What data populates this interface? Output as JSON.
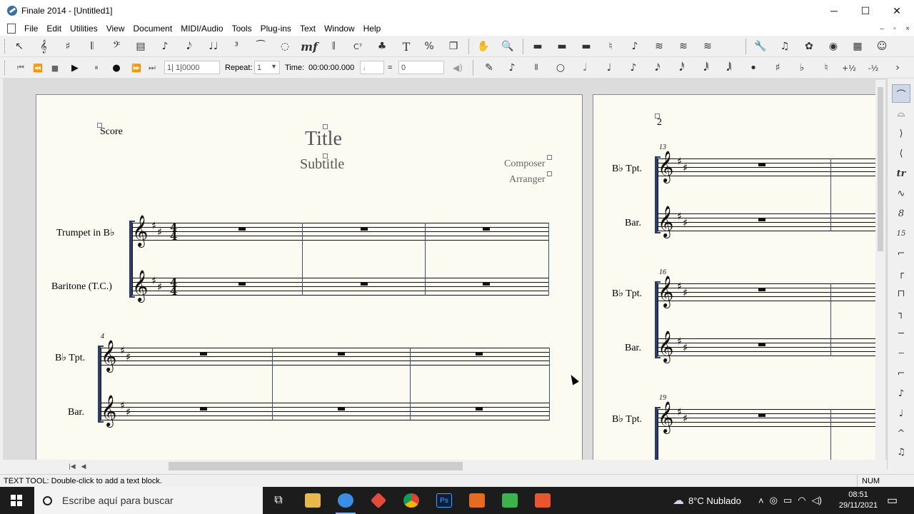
{
  "window": {
    "title": "Finale 2014 - [Untitled1]",
    "minimize": "─",
    "maximize": "☐",
    "close": "✕"
  },
  "menu": {
    "items": [
      "File",
      "Edit",
      "Utilities",
      "View",
      "Document",
      "MIDI/Audio",
      "Tools",
      "Plug-ins",
      "Text",
      "Window",
      "Help"
    ],
    "doc_min": "–",
    "doc_restore": "▫",
    "doc_close": "×"
  },
  "toolbar1": {
    "tools": [
      "↖",
      "𝄞",
      "♯",
      "𝄃",
      "𝄢",
      "▤",
      "♪",
      "𝅘𝅥𝅮",
      "♩♩",
      "³",
      "⁀",
      "◌",
      "mf",
      "𝄂",
      "C⁷",
      "♣",
      "T",
      "%",
      "❐",
      "✋",
      "🔍",
      "▬",
      "▬",
      "▬",
      "♮",
      "♪",
      "≋",
      "≋",
      "≋",
      "🔧",
      "♫",
      "✿",
      "◉",
      "▦",
      "☺"
    ]
  },
  "transport": {
    "rewind": "⏮",
    "back": "⏪",
    "stop": "■",
    "play": "▶",
    "pause": "⏸",
    "record": "●",
    "forward": "⏩",
    "end": "⏭"
  },
  "counter": {
    "position": "1| 1|0000",
    "repeat_label": "Repeat:",
    "repeat_value": "1",
    "time_label": "Time:",
    "time_value": "00:00:00.000",
    "eq": "=",
    "tempo_value": "0"
  },
  "toolbar2": {
    "tools": [
      "✎",
      "♪",
      "⦀",
      "○",
      "𝅗𝅥",
      "♩",
      "♪",
      "𝅘𝅥𝅯",
      "𝅘𝅥𝅰",
      "𝅘𝅥𝅱",
      "𝅘𝅥𝅲",
      "•",
      "♯",
      "♭",
      "♮",
      "+½",
      "-½"
    ]
  },
  "page1": {
    "score_label": "Score",
    "title": "Title",
    "subtitle": "Subtitle",
    "composer": "Composer",
    "arranger": "Arranger",
    "system1": {
      "staff_names": [
        "Trumpet in B♭",
        "Baritone (T.C.)"
      ],
      "time_sig_top": "4",
      "time_sig_bottom": "4"
    },
    "system2": {
      "measure_number": "4",
      "staff_names": [
        "B♭ Tpt.",
        "Bar."
      ]
    }
  },
  "page2": {
    "page_number": "2",
    "systems": [
      {
        "measure_number": "13",
        "staff_names": [
          "B♭ Tpt.",
          "Bar."
        ]
      },
      {
        "measure_number": "16",
        "staff_names": [
          "B♭ Tpt.",
          "Bar."
        ]
      },
      {
        "measure_number": "19",
        "staff_names": [
          "B♭ Tpt."
        ]
      }
    ]
  },
  "palette": {
    "tools": [
      "⌒",
      "⌓",
      "⟩",
      "⟨",
      "tr",
      "∿",
      "8",
      "15",
      "⌐",
      "┌",
      "⊓",
      "┐",
      "─",
      "┄",
      "⌐",
      "♪",
      "♩",
      "^",
      "♫",
      "✱"
    ]
  },
  "status": {
    "text": "TEXT TOOL: Double-click to add a text block.",
    "num": "NUM"
  },
  "taskbar": {
    "search_placeholder": "Escribe aquí para buscar",
    "weather": "8°C  Nublado",
    "time": "08:51",
    "date": "29/11/2021",
    "app_colors": [
      "#3a8ee6",
      "#e8b84a",
      "#2f8ccf",
      "#e24a3b",
      "#f4b400",
      "#1e3a8a",
      "#e66b1e",
      "#3bb34a",
      "#e8562f"
    ]
  },
  "colors": {
    "page_bg": "#fcfbf2",
    "bracket": "#2b3e6b",
    "selected_tool": "#cfd8e6"
  }
}
